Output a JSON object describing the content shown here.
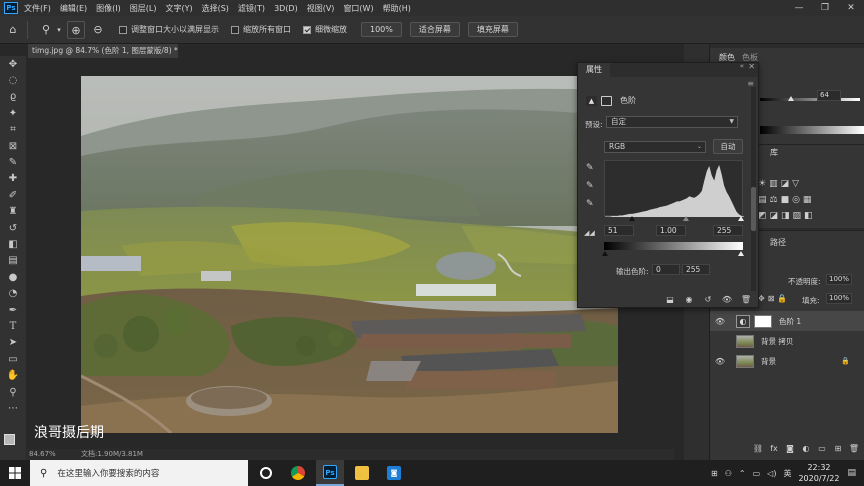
{
  "menubar": {
    "items": [
      "文件(F)",
      "编辑(E)",
      "图像(I)",
      "图层(L)",
      "文字(Y)",
      "选择(S)",
      "滤镜(T)",
      "3D(D)",
      "视图(V)",
      "窗口(W)",
      "帮助(H)"
    ],
    "logo": "Ps",
    "controls": [
      "—",
      "❐",
      "✕"
    ]
  },
  "options": {
    "resize_windows_label": "调整窗口大小以满屏显示",
    "zoom_all_label": "缩放所有窗口",
    "scrubby_zoom_label": "细微缩放",
    "zoom_100_label": "100%",
    "fit_screen_label": "适合屏幕",
    "fill_screen_label": "填充屏幕"
  },
  "document": {
    "tab_title": "timg.jpg @ 84.7% (色阶 1, 图层蒙版/8) *",
    "watermark": "浪哥摄后期"
  },
  "status": {
    "zoom": "84.67%",
    "doc_size": "文档:1.90M/3.81M"
  },
  "properties": {
    "title": "属性",
    "type_label": "色阶",
    "preset_label": "预设:",
    "preset_value": "自定",
    "channel_value": "RGB",
    "auto_label": "自动",
    "input_black": "51",
    "input_gamma": "1.00",
    "input_white": "255",
    "output_label": "输出色阶:",
    "output_black": "0",
    "output_white": "255",
    "histogram": [
      1,
      1,
      1,
      2,
      2,
      2,
      3,
      3,
      4,
      5,
      6,
      6,
      7,
      8,
      9,
      10,
      11,
      12,
      14,
      15,
      16,
      17,
      19,
      20,
      21,
      22,
      24,
      26,
      28,
      30,
      30,
      32,
      34,
      36,
      40,
      38,
      37,
      40,
      44,
      50,
      70,
      88,
      98,
      80,
      70,
      90,
      100,
      82,
      60,
      48,
      40,
      30,
      20,
      10,
      5,
      2,
      1
    ]
  },
  "color_panel": {
    "tabs": [
      "颜色",
      "色板"
    ],
    "value": "64"
  },
  "libraries_panel": {
    "tab": "库"
  },
  "layers_panel": {
    "tabs_right": "路径",
    "opacity_label": "不透明度:",
    "opacity_value": "100%",
    "fill_label": "填充:",
    "fill_value": "100%",
    "layers": [
      {
        "name": "色阶 1",
        "visible": true,
        "selected": true
      },
      {
        "name": "背景 拷贝",
        "visible": false,
        "selected": false
      },
      {
        "name": "背景",
        "visible": true,
        "selected": false
      }
    ]
  },
  "taskbar": {
    "search_placeholder": "在这里输入你要搜索的内容",
    "time": "22:32",
    "date": "2020/7/22",
    "apps": [
      "cortana",
      "chrome",
      "photoshop",
      "file-explorer",
      "capture"
    ]
  }
}
